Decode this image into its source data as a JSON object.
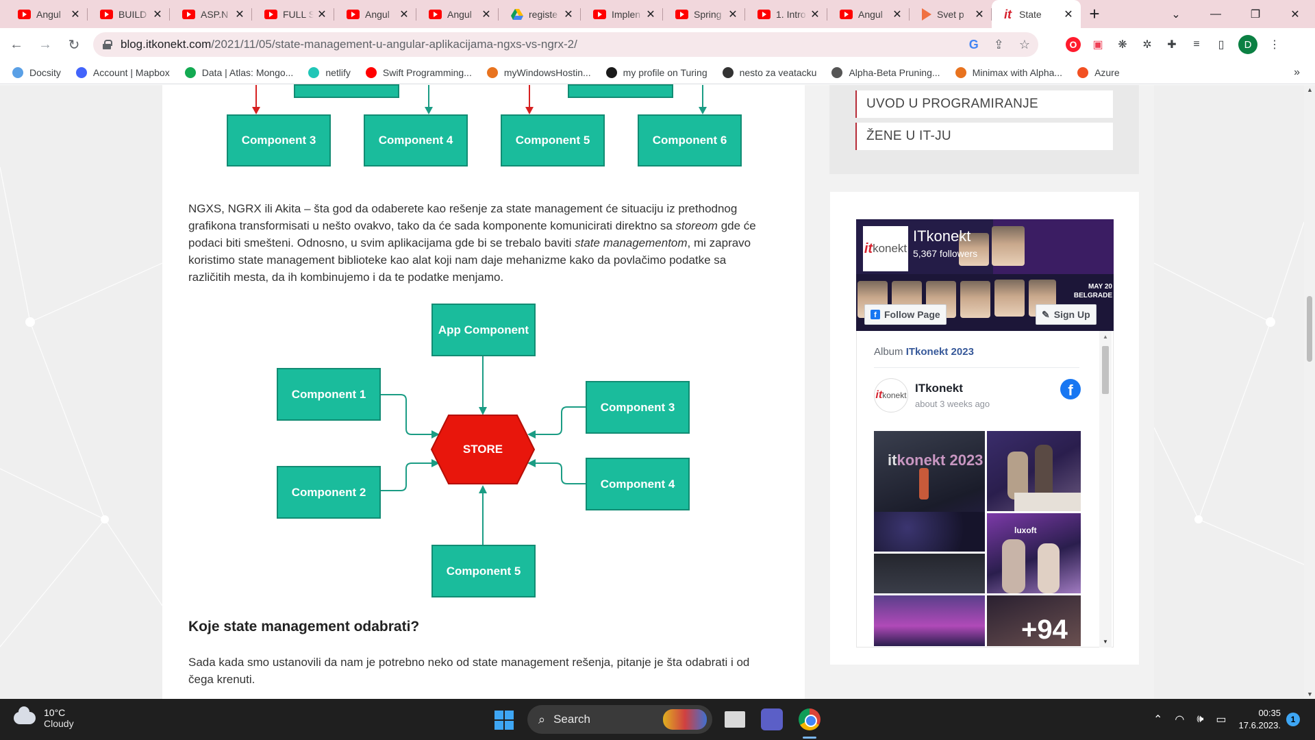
{
  "browser": {
    "tabs": [
      {
        "label": "Angul",
        "icon": "youtube-icon"
      },
      {
        "label": "BUILD",
        "icon": "youtube-icon"
      },
      {
        "label": "ASP.N",
        "icon": "youtube-icon"
      },
      {
        "label": "FULL S",
        "icon": "youtube-icon"
      },
      {
        "label": "Angul",
        "icon": "youtube-icon"
      },
      {
        "label": "Angul",
        "icon": "youtube-icon"
      },
      {
        "label": "registe",
        "icon": "google-drive-icon"
      },
      {
        "label": "Implen",
        "icon": "youtube-icon"
      },
      {
        "label": "Spring",
        "icon": "youtube-icon"
      },
      {
        "label": "1. Intro",
        "icon": "youtube-icon"
      },
      {
        "label": "Angul",
        "icon": "youtube-icon"
      },
      {
        "label": "Svet p",
        "icon": "play-icon"
      },
      {
        "label": "State",
        "icon": "itkonekt-icon",
        "active": true
      }
    ],
    "url_host": "blog.itkonekt.com",
    "url_path": "/2021/11/05/state-management-u-angular-aplikacijama-ngxs-vs-ngrx-2/",
    "profile_initial": "D",
    "bookmarks": [
      {
        "label": "Docsity",
        "color": "#5aa0e6"
      },
      {
        "label": "Account | Mapbox",
        "color": "#4264fb"
      },
      {
        "label": "Data | Atlas: Mongo...",
        "color": "#13aa52"
      },
      {
        "label": "netlify",
        "color": "#20c6b7"
      },
      {
        "label": "Swift Programming...",
        "color": "#ff0000"
      },
      {
        "label": "myWindowsHostin...",
        "color": "#e8731f"
      },
      {
        "label": "my profile on Turing",
        "color": "#1a1a1a"
      },
      {
        "label": "nesto za veatacku",
        "color": "#333333"
      },
      {
        "label": "Alpha-Beta Pruning...",
        "color": "#555555"
      },
      {
        "label": "Minimax with Alpha...",
        "color": "#e8731f"
      },
      {
        "label": "Azure",
        "color": "#f25022"
      }
    ]
  },
  "diagram_top": {
    "boxes": [
      "Component 3",
      "Component 4",
      "Component 5",
      "Component 6"
    ]
  },
  "article": {
    "para1_a": "NGXS, NGRX ili Akita – šta god da odaberete kao rešenje za state management će situaciju iz prethodnog",
    "para1_b": "grafikona transformisati u nešto ovakvo, tako da će sada komponente komunicirati direktno sa ",
    "para1_b_em": "storeom",
    "para1_b_end": " gde će",
    "para1_c": "podaci biti smešteni. Odnosno, u svim aplikacijama gde bi se trebalo baviti ",
    "para1_c_em": "state managementom",
    "para1_c_end": ", mi zapravo",
    "para1_d": "koristimo state management biblioteke kao alat koji nam daje mehanizme kako da povlačimo podatke sa",
    "para1_e": "različitih mesta, da ih kombinujemo i da te podatke menjamo.",
    "heading": "Koje state management odabrati?",
    "para2_a": "Sada kada smo ustanovili da nam je potrebno neko od state management rešenja, pitanje je šta odabrati i od",
    "para2_b": "čega krenuti."
  },
  "diagram_store": {
    "app": "App Component",
    "store": "STORE",
    "c1": "Component 1",
    "c2": "Component  2",
    "c3": "Component 3",
    "c4": "Component 4",
    "c5": "Component 5"
  },
  "sidebar": {
    "menu": [
      "UVOD U PROGRAMIRANJE",
      "ŽENE U IT-JU"
    ],
    "fb": {
      "page_name": "ITkonekt",
      "followers": "5,367 followers",
      "follow_label": "Follow Page",
      "signup_label": "Sign Up",
      "album_prefix": "Album",
      "album_name": "ITkonekt 2023",
      "post_name": "ITkonekt",
      "post_time": "about 3 weeks ago",
      "more_photos": "+94",
      "cover_text": "MAY 20 BELGRADE"
    }
  },
  "taskbar": {
    "temp": "10°C",
    "condition": "Cloudy",
    "search": "Search",
    "time": "00:35",
    "date": "17.6.2023.",
    "notifications": "1"
  },
  "colors": {
    "teal": "#1abc9c",
    "store_red": "#e8160c",
    "arrow_red": "#d62020",
    "brand": "#d6232f"
  }
}
